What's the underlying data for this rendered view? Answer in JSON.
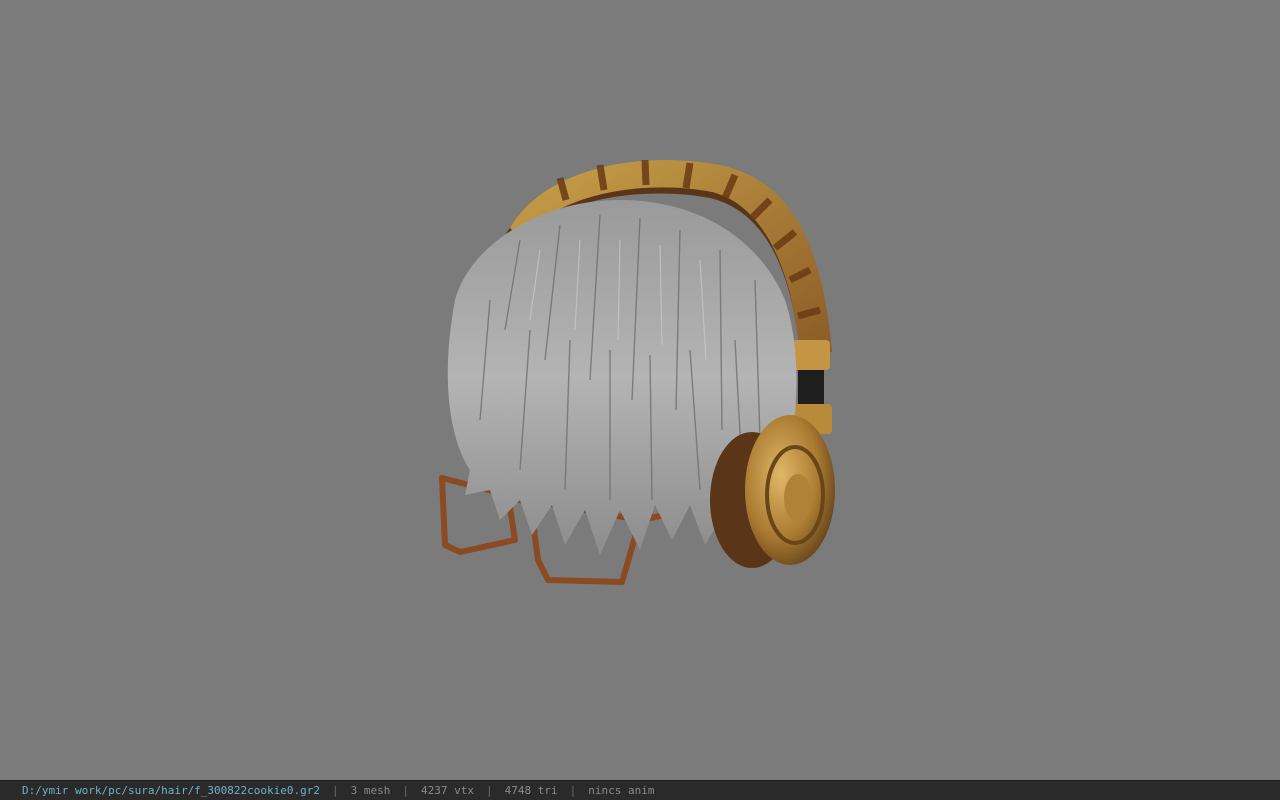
{
  "viewport": {
    "background_color": "#7b7b7b",
    "model_icon": "hair-headphones-glasses-model"
  },
  "status_bar": {
    "file_path": "D:/ymir work/pc/sura/hair/f_300822cookie0.gr2",
    "mesh_count": "3 mesh",
    "vertex_count": "4237 vtx",
    "triangle_count": "4748 tri",
    "anim_status": "nincs anim",
    "separator": "|",
    "path_color": "#6fb3c6",
    "text_color": "#8a8a8a"
  }
}
